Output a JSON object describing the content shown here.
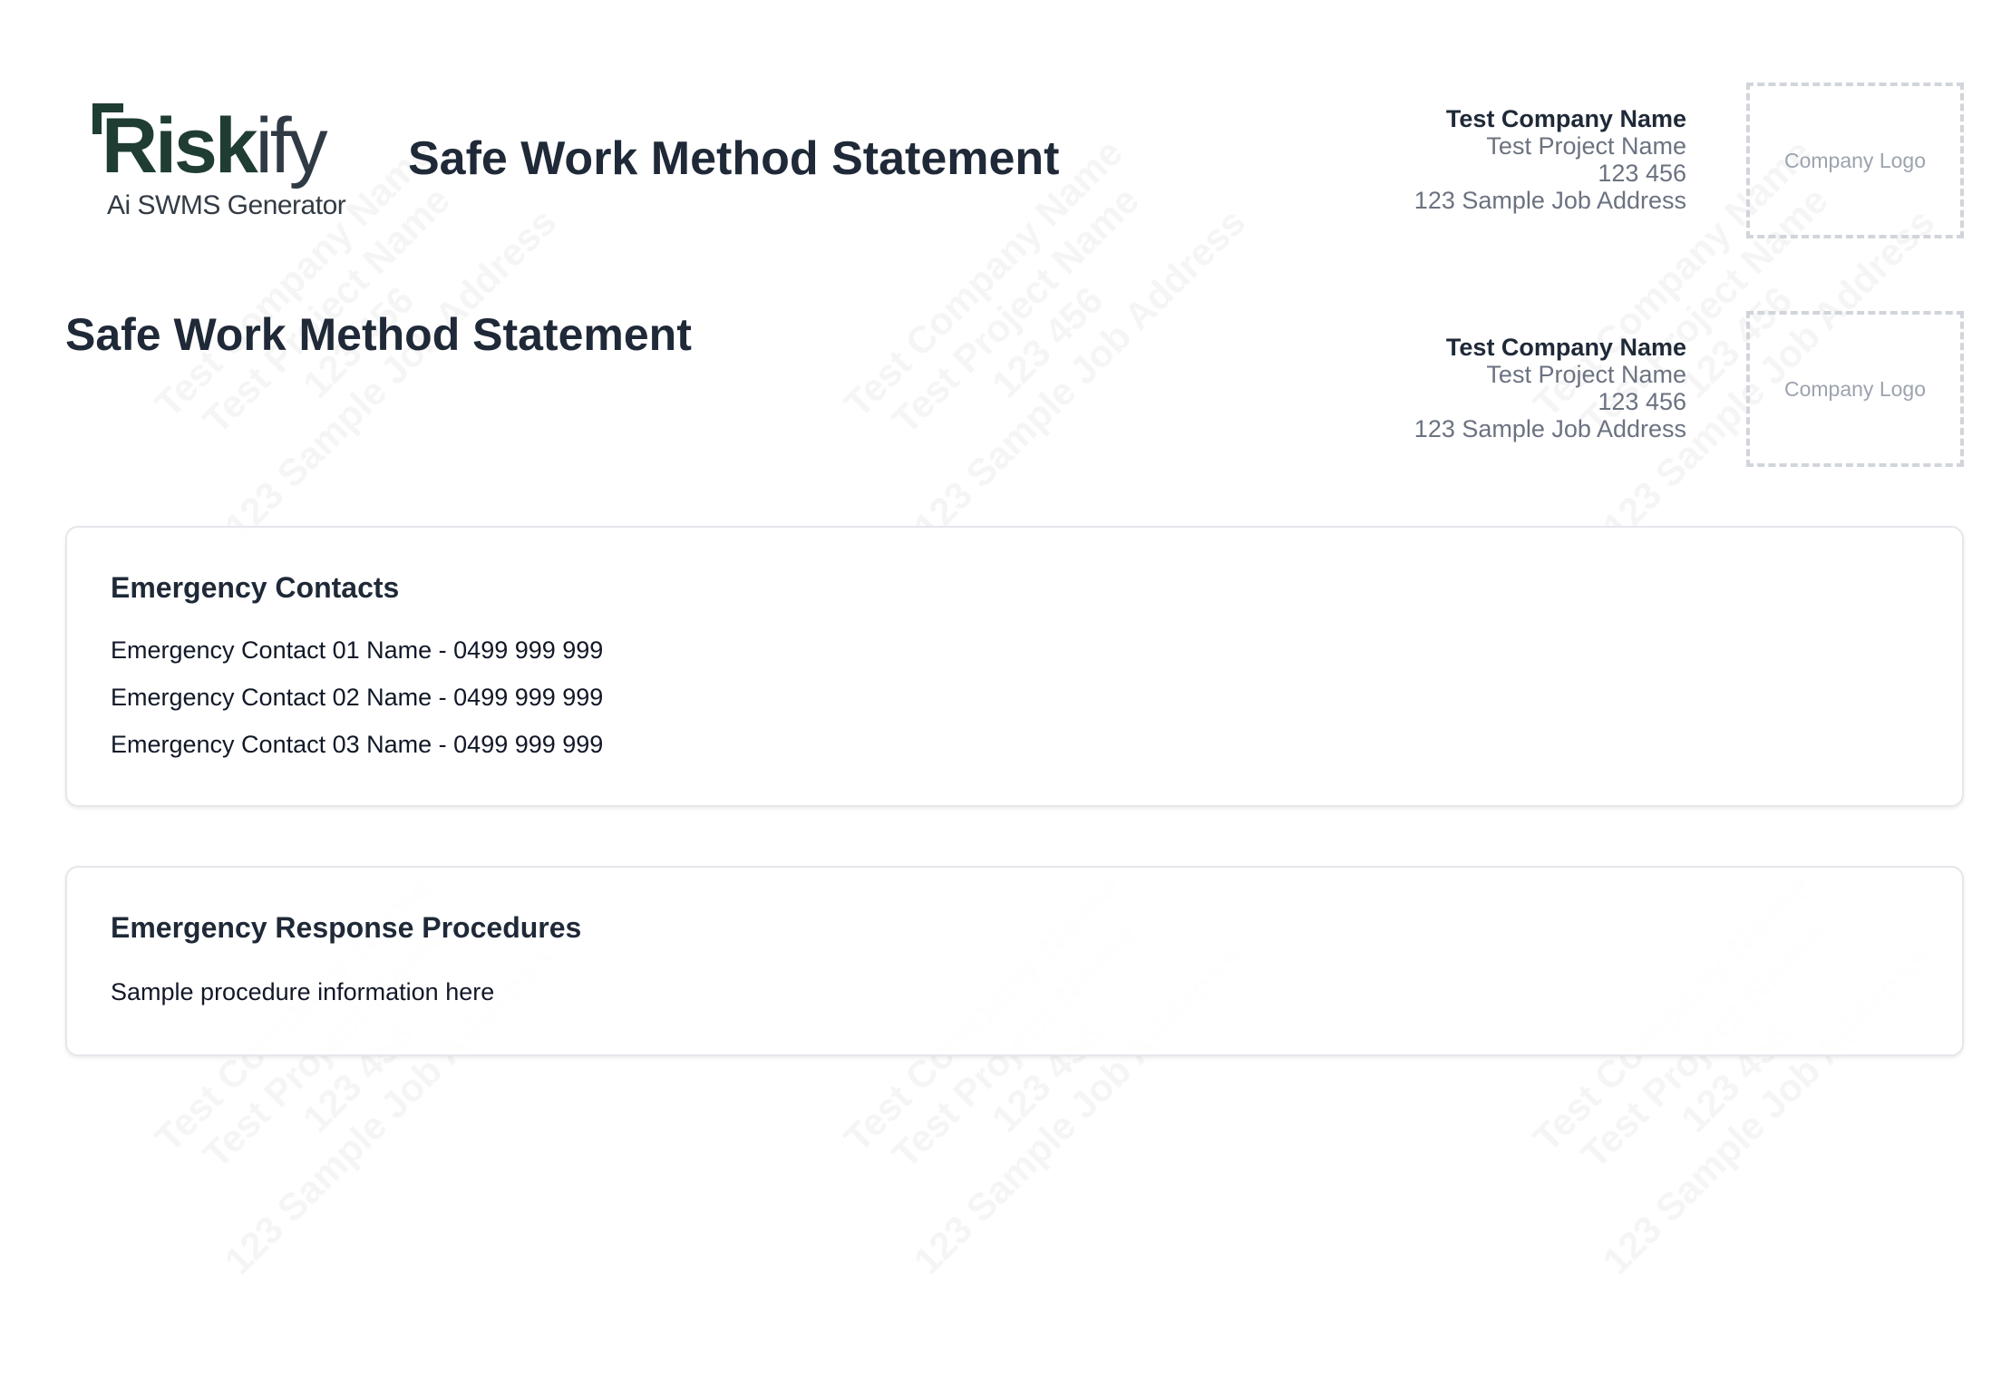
{
  "brand": {
    "name_bold": "Risk",
    "name_light": "ify",
    "tagline": "Ai SWMS Generator"
  },
  "header": {
    "title": "Safe Work Method Statement"
  },
  "company": {
    "name": "Test Company Name",
    "project": "Test Project Name",
    "number": "123 456",
    "address": "123 Sample Job Address",
    "logo_placeholder": "Company Logo"
  },
  "page_title": "Safe Work Method Statement",
  "emergency_contacts": {
    "title": "Emergency Contacts",
    "items": [
      "Emergency Contact 01 Name - 0499 999 999",
      "Emergency Contact 02 Name - 0499 999 999",
      "Emergency Contact 03 Name - 0499 999 999"
    ]
  },
  "emergency_procedures": {
    "title": "Emergency Response Procedures",
    "text": "Sample procedure information here"
  },
  "watermark": {
    "lines": [
      "Test Company Name",
      "Test Project Name",
      "123 456",
      "123 Sample Job Address"
    ]
  },
  "colors": {
    "brand_green": "#1f3d33",
    "text_dark": "#1f2937",
    "text_muted": "#6b7280",
    "border": "#e5e7eb",
    "dashed_border": "#d1d5db"
  }
}
